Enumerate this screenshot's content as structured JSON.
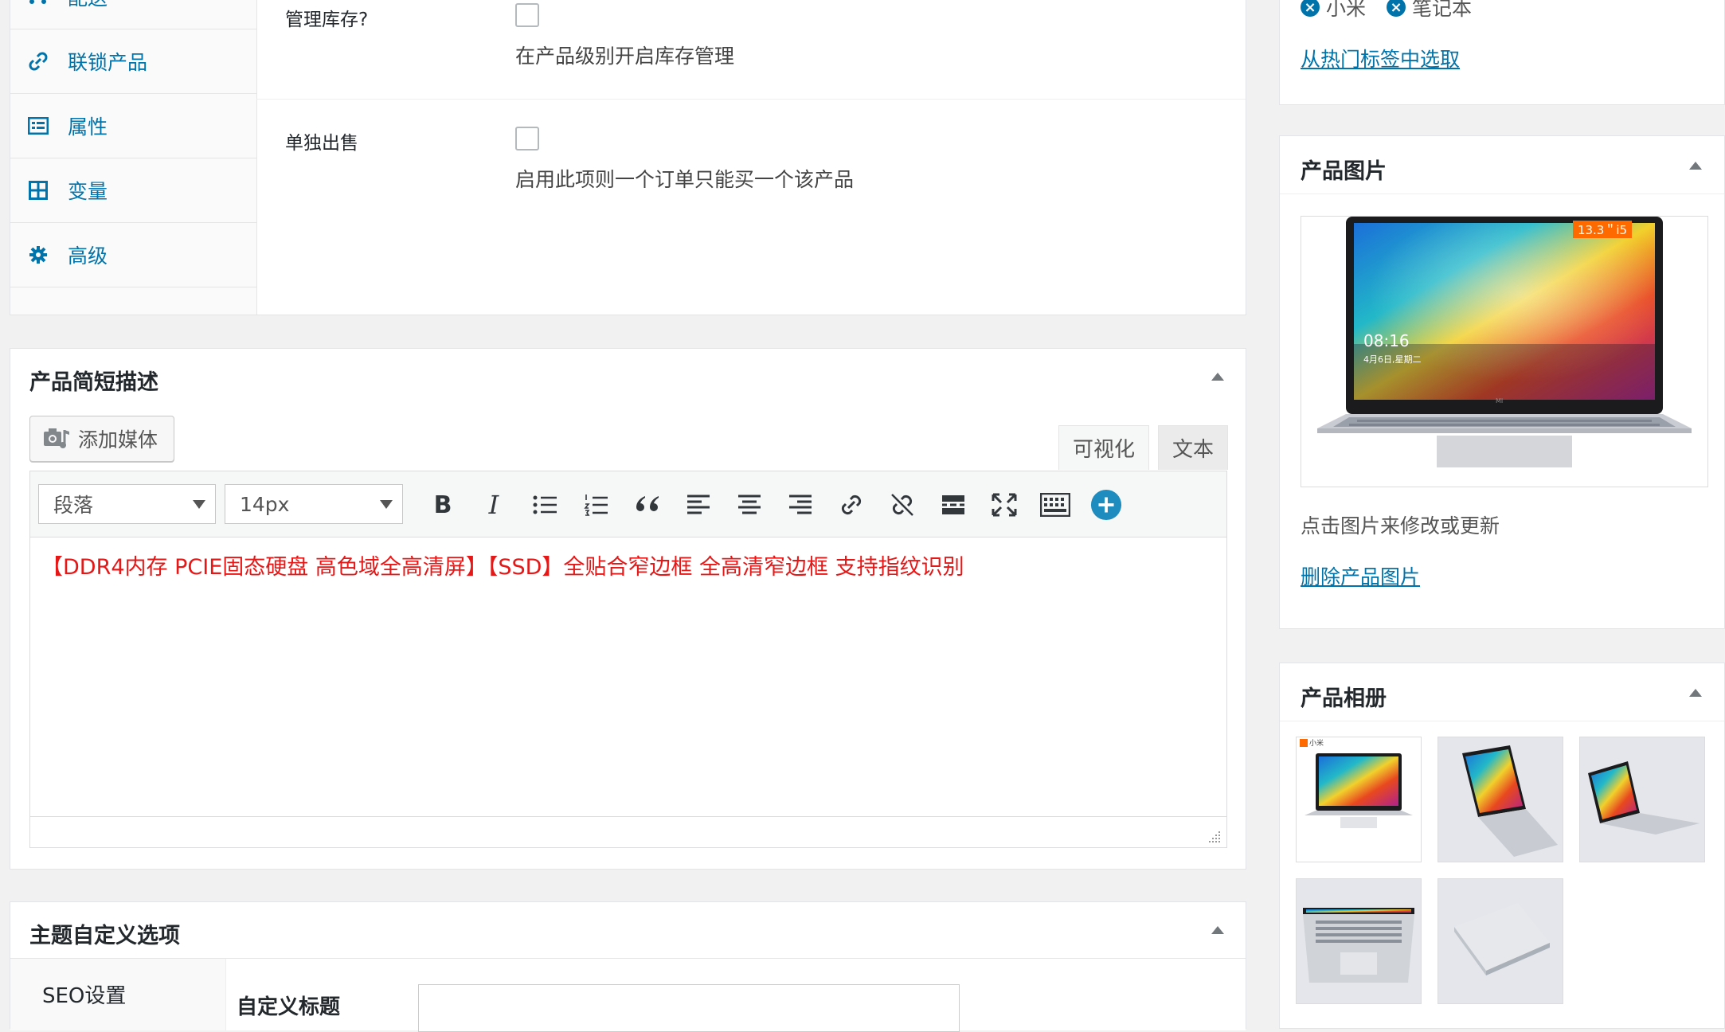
{
  "product_data": {
    "tabs": [
      {
        "label": "配送",
        "icon": "truck-icon"
      },
      {
        "label": "联锁产品",
        "icon": "link-icon"
      },
      {
        "label": "属性",
        "icon": "list-icon"
      },
      {
        "label": "变量",
        "icon": "grid-icon"
      },
      {
        "label": "高级",
        "icon": "gear-icon"
      }
    ],
    "manage_stock_label": "管理库存?",
    "manage_stock_desc": "在产品级别开启库存管理",
    "sold_individually_label": "单独出售",
    "sold_individually_desc": "启用此项则一个订单只能买一个该产品"
  },
  "short_description": {
    "title": "产品简短描述",
    "add_media_label": "添加媒体",
    "tab_visual": "可视化",
    "tab_text": "文本",
    "format_select": "段落",
    "font_size_select": "14px",
    "content": "【DDR4内存 PCIE固态硬盘 高色域全高清屏】【SSD】全贴合窄边框 全高清窄边框 支持指纹识别",
    "content_color": "#e61717"
  },
  "theme_options": {
    "title": "主题自定义选项",
    "seo_label": "SEO设置",
    "custom_title_label": "自定义标题"
  },
  "tags": {
    "items": [
      "小米",
      "笔记本"
    ],
    "choose_popular": "从热门标签中选取"
  },
  "product_image": {
    "title": "产品图片",
    "badge": "13.3＂i5",
    "screen_time": "08:16",
    "screen_date": "4月6日,星期二",
    "logo_text": "MI",
    "hint": "点击图片来修改或更新",
    "remove_link": "删除产品图片"
  },
  "gallery": {
    "title": "产品相册",
    "first_brand": "小米"
  },
  "colors": {
    "link": "#0073aa",
    "accent_blue": "#1e8cbe",
    "badge_orange": "#ff6a00"
  }
}
